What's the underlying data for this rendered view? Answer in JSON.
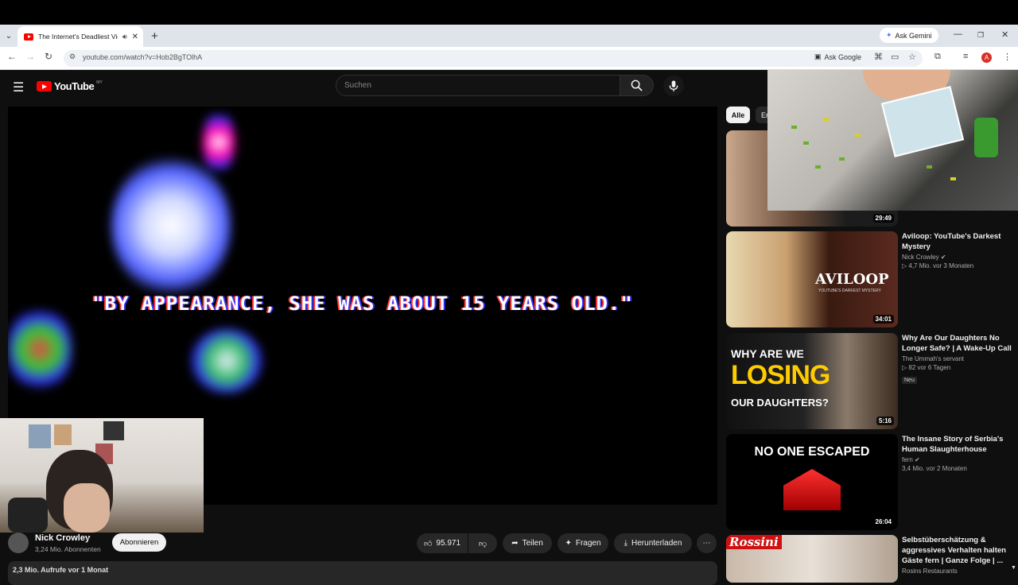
{
  "browser": {
    "tab_title": "The Internet's Deadliest Vid",
    "new_tab": "+",
    "ask_gemini": "Ask Gemini",
    "url": "youtube.com/watch?v=Hob2BgTOlhA",
    "ask_google": "Ask Google",
    "profile_initial": "A"
  },
  "youtube": {
    "logo": "YouTube",
    "country": "MY",
    "search_placeholder": "Suchen"
  },
  "player": {
    "subtitle": "\"BY APPEARANCE, SHE WAS ABOUT 15 YEARS OLD.\""
  },
  "channel": {
    "name": "Nick Crowley",
    "subscribers": "3,24 Mio. Abonnenten",
    "subscribe_label": "Abonnieren"
  },
  "actions": {
    "likes": "95.971",
    "share": "Teilen",
    "ask": "Fragen",
    "download": "Herunterladen",
    "more": "⋯"
  },
  "video_stats": "2,3 Mio. Aufrufe  vor 1 Monat",
  "sidebar": {
    "chips": [
      "Alle",
      "Er"
    ],
    "pip_duration": "29:49",
    "items": [
      {
        "title": "Aviloop: YouTube's Darkest Mystery",
        "channel": "Nick Crowley",
        "stats": "▷ 4,7 Mio.  vor 3 Monaten",
        "duration": "34:01",
        "thumb_text": "AVILOOP",
        "thumb_sub": "YOUTUBE'S DARKEST MYSTERY"
      },
      {
        "title": "Why Are Our Daughters No Longer Safe? | A Wake-Up Call",
        "channel": "The Ummah's servant",
        "stats": "▷ 82  vor 6 Tagen",
        "badge": "Neu",
        "duration": "5:16",
        "thumb_l1": "WHY ARE WE",
        "thumb_l2": "LOSING",
        "thumb_l3": "OUR DAUGHTERS?"
      },
      {
        "title": "The Insane Story of Serbia's Human Slaughterhouse",
        "channel": "fern",
        "stats": "3,4 Mio.  vor 2 Monaten",
        "duration": "26:04",
        "thumb_text": "NO ONE ESCAPED"
      },
      {
        "title": "Selbstüberschätzung & aggressives Verhalten halten Gäste fern | Ganze Folge | ...",
        "channel": "Rosins Restaurants",
        "thumb_text": "Rossini"
      }
    ]
  },
  "colors": {
    "yt_red": "#ff0000",
    "bg": "#0f0f0f",
    "pill": "#272727"
  }
}
